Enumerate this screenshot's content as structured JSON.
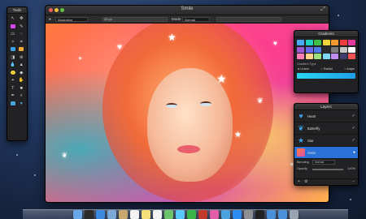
{
  "window": {
    "title": "Smile"
  },
  "toolbar": {
    "preset_value": "Illustration",
    "zoom_value": "30 px",
    "mode_label": "Mode",
    "mode_value": "Normal"
  },
  "tools_panel": {
    "title": "Tools"
  },
  "gradients_panel": {
    "title": "Gradients",
    "swatch_colors": [
      "#49a9f2",
      "#1fd2c0",
      "#3fbf4a",
      "#f1d33a",
      "#f29a2e",
      "#ef3d3d",
      "#e23a9c",
      "#9b59d6",
      "#6a6aee",
      "#4e7de8",
      "#2b2b2b",
      "#7a7a7a",
      "#c4c4c4",
      "#ffffff",
      "#ff7eb3",
      "#ffd28a",
      "#9de07f",
      "#7dd8f2",
      "#bf8cf2",
      "#3d3d6b",
      "#f25252"
    ],
    "gradient_type_label": "Gradient Type",
    "types": [
      "Linear",
      "Radial",
      "Angle"
    ],
    "bar_colors": [
      "#2ad6f2",
      "#1e9fe8"
    ]
  },
  "layers_panel": {
    "title": "Layers",
    "layers": [
      {
        "name": "Heart",
        "icon": "heart-icon",
        "visible": true
      },
      {
        "name": "Butterfly",
        "icon": "butterfly-icon",
        "visible": true
      },
      {
        "name": "Star",
        "icon": "star-icon",
        "visible": true
      },
      {
        "name": "Smile",
        "icon": "photo-thumbnail",
        "visible": true,
        "selected": true
      }
    ],
    "blending_label": "Blending",
    "blending_value": "Normal",
    "opacity_label": "Opacity",
    "opacity_value": "100%"
  },
  "dock": {
    "icons": [
      "finder-icon",
      "dashboard-icon",
      "safari-icon",
      "mail-icon",
      "contacts-icon",
      "calendar-icon",
      "notes-icon",
      "reminders-icon",
      "maps-icon",
      "messages-icon",
      "facetime-icon",
      "photo-booth-icon",
      "itunes-icon",
      "iphoto-icon",
      "app-store-icon",
      "preferences-icon",
      "pixelmator-icon",
      "folder-icon",
      "downloads-icon",
      "trash-icon"
    ],
    "colors": [
      "#6aa7e8",
      "#2b2b2b",
      "#3a88e0",
      "#7aa8d8",
      "#c9a66b",
      "#f2f2f2",
      "#f4e07a",
      "#f2f2f2",
      "#6cc36a",
      "#5ac8fa",
      "#3bb54a",
      "#c0392b",
      "#e25ca8",
      "#4aa3df",
      "#2d8cf0",
      "#8e8e93",
      "#222",
      "#4a90d9",
      "#4a90d9",
      "#9aa4b0"
    ]
  }
}
